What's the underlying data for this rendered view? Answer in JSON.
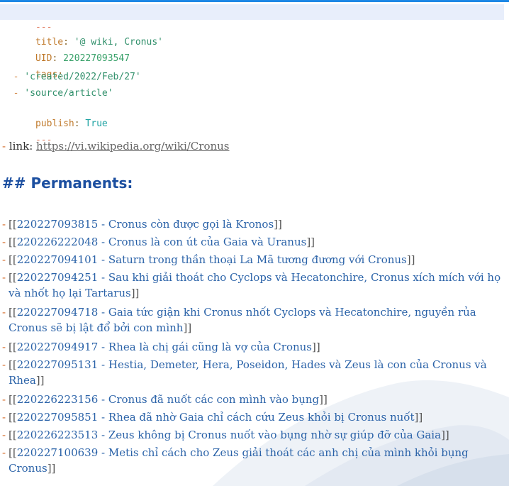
{
  "frontmatter": {
    "delimiter": "---",
    "title_key": "title",
    "title_value": "'@ wiki, Cronus'",
    "uid_key": "UID",
    "uid_value": "220227093547",
    "tags_key": "tags",
    "tags": [
      "'created/2022/Feb/27'",
      "'source/article'"
    ],
    "publish_key": "publish",
    "publish_value": "True"
  },
  "link": {
    "dash": "-",
    "label": "link:",
    "url": "https://vi.wikipedia.org/wiki/Cronus"
  },
  "section_heading": "## Permanents:",
  "permanents": [
    {
      "id": "220227093815",
      "text": "Cronus còn được gọi là Kronos"
    },
    {
      "id": "220226222048",
      "text": "Cronus là con út của Gaia và Uranus"
    },
    {
      "id": "220227094101",
      "text": "Saturn trong thần thoại La Mã tương đương với Cronus"
    },
    {
      "id": "220227094251",
      "text": "Sau khi giải thoát cho Cyclops và Hecatonchire, Cronus xích mích với họ và nhốt họ lại Tartarus"
    },
    {
      "id": "220227094718",
      "text": "Gaia tức giận khi Cronus nhốt Cyclops và Hecatonchire, nguyền rủa Cronus sẽ bị lật đổ bởi con mình"
    },
    {
      "id": "220227094917",
      "text": "Rhea là chị gái cũng là vợ của Cronus"
    },
    {
      "id": "220227095131",
      "text": "Hestia, Demeter, Hera, Poseidon, Hades và Zeus là con của Cronus và Rhea"
    },
    {
      "id": "220226223156",
      "text": "Cronus đã nuốt các con mình vào bụng"
    },
    {
      "id": "220227095851",
      "text": "Rhea đã nhờ Gaia chỉ cách cứu Zeus khỏi bị Cronus nuốt"
    },
    {
      "id": "220226223513",
      "text": "Zeus không bị Cronus nuốt vào bụng nhờ sự giúp đỡ của Gaia"
    },
    {
      "id": "220227100639",
      "text": "Metis chỉ cách cho Zeus giải thoát các anh chị của mình khỏi bụng Cronus"
    }
  ],
  "colors": {
    "accent_bar": "#1e88e5",
    "heading": "#1c4fa0",
    "wikilink": "#2a62a8",
    "list_dash": "#d46b2a"
  }
}
